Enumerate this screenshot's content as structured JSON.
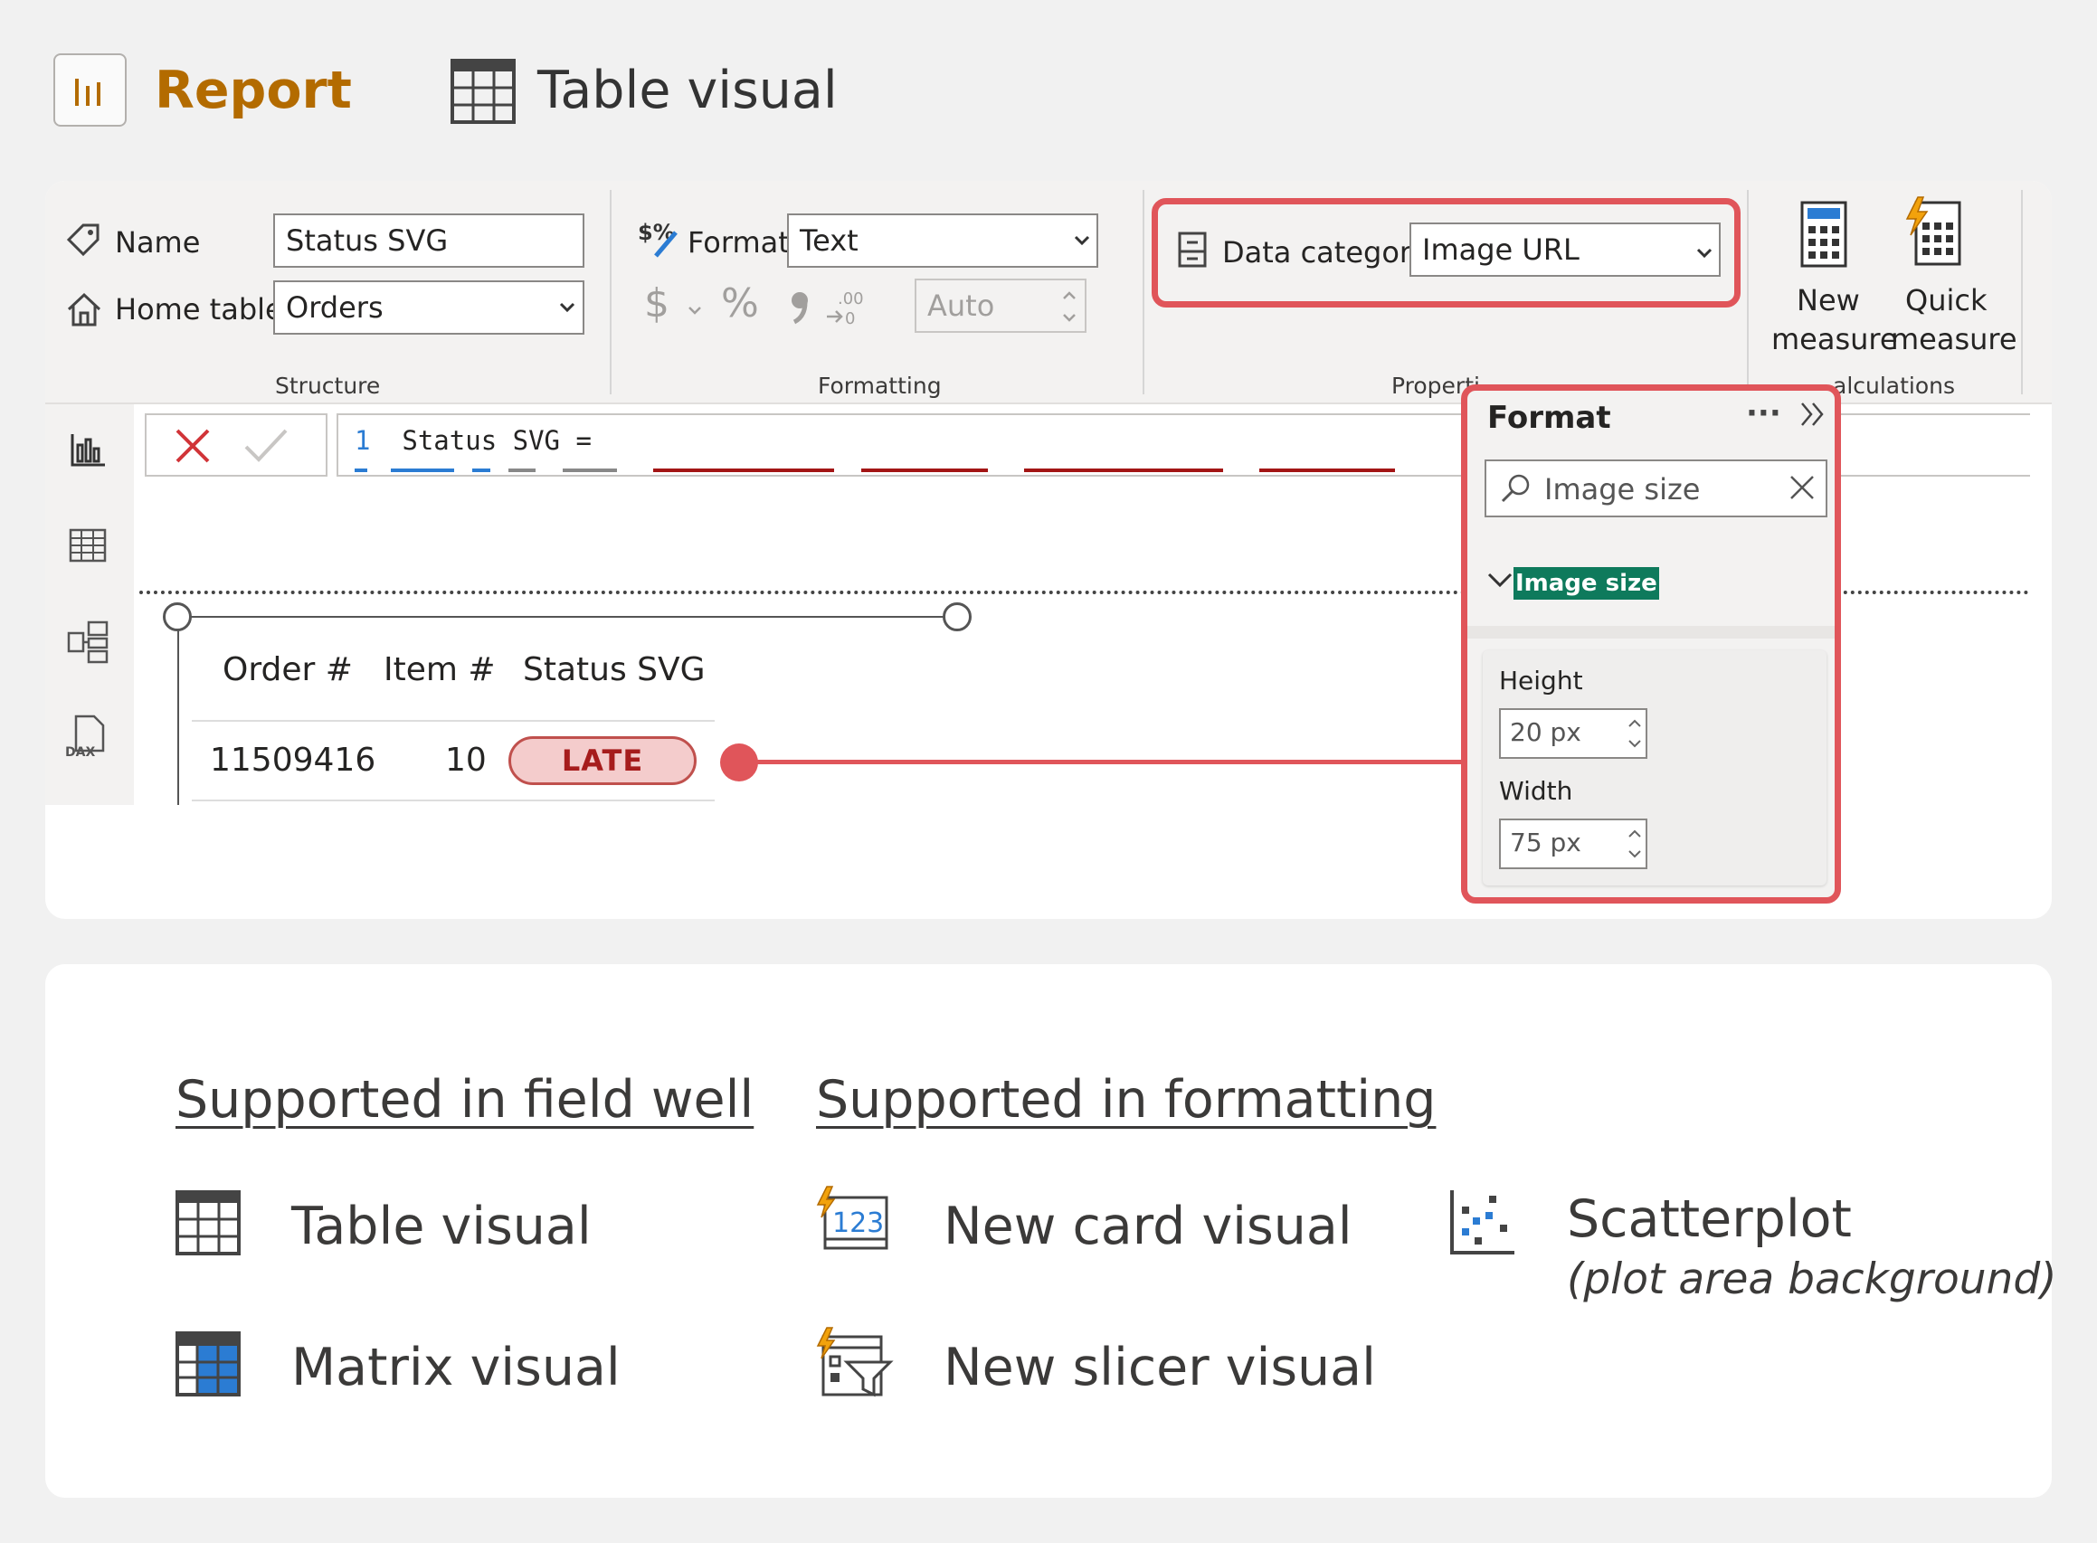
{
  "header": {
    "report_label": "Report",
    "table_visual_label": "Table visual"
  },
  "ribbon": {
    "structure": {
      "name_label": "Name",
      "name_value": "Status SVG",
      "home_table_label": "Home table",
      "home_table_value": "Orders",
      "group_label": "Structure"
    },
    "formatting": {
      "format_label": "Format",
      "format_value": "Text",
      "currency_symbol": "$",
      "percent_symbol": "%",
      "comma_symbol": "\"",
      "decimals_value": "Auto",
      "group_label": "Formatting"
    },
    "properties": {
      "data_category_label": "Data category",
      "data_category_value": "Image URL",
      "group_label": "Properti"
    },
    "calculations": {
      "new_measure_line1": "New",
      "new_measure_line2": "measure",
      "quick_measure_line1": "Quick",
      "quick_measure_line2": "measure",
      "group_label": "alculations"
    }
  },
  "formula": {
    "line_number": "1",
    "code": "Status SVG ="
  },
  "table_visual": {
    "columns": [
      "Order #",
      "Item #",
      "Status SVG"
    ],
    "row": {
      "order": "11509416",
      "item": "10",
      "status": "LATE"
    }
  },
  "format_pane": {
    "title": "Format",
    "more": "···",
    "search_value": "Image size",
    "section_label": "Image size",
    "height_label": "Height",
    "height_value": "20 px",
    "width_label": "Width",
    "width_value": "75 px"
  },
  "supported": {
    "field_well_heading": "Supported in field well",
    "formatting_heading": "Supported in formatting",
    "field_well_items": [
      "Table visual",
      "Matrix visual"
    ],
    "formatting_items": [
      "New card visual",
      "New slicer visual"
    ],
    "scatter_label": "Scatterplot",
    "scatter_note": "(plot area background)",
    "card_icon_text": "123"
  },
  "colors": {
    "accent_red": "#e0555a",
    "report_gold": "#b36b00",
    "late_fill": "#f4cccc",
    "section_highlight": "#0e7a5c"
  }
}
